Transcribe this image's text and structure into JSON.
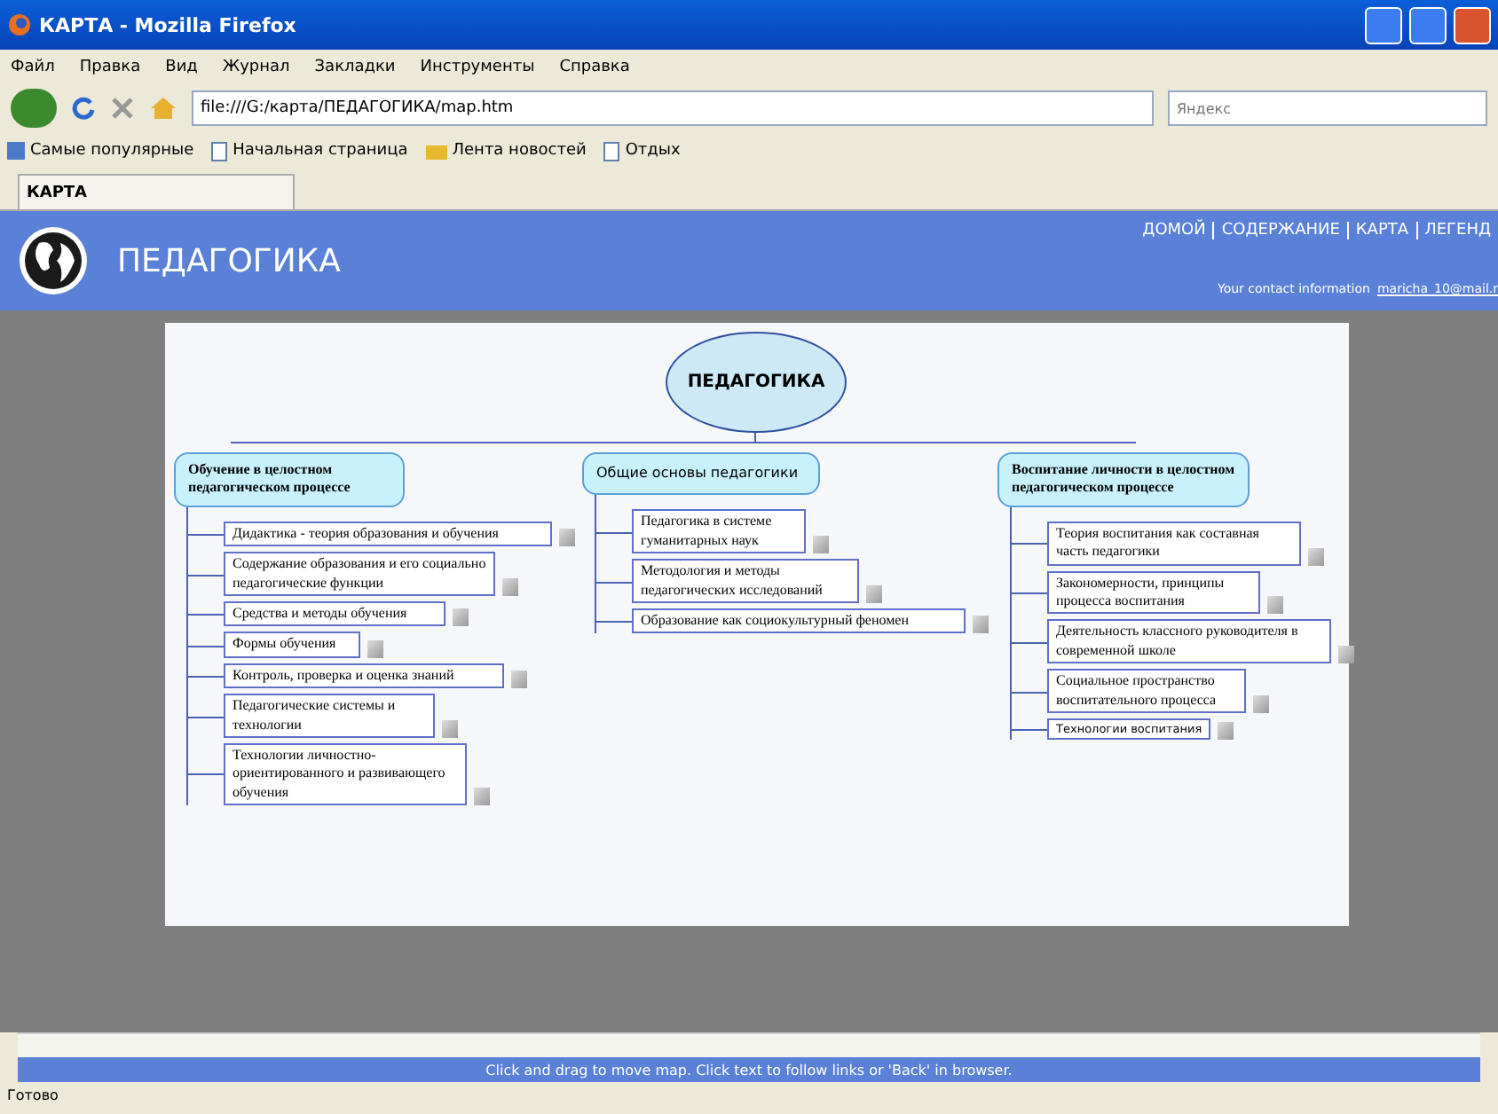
{
  "window": {
    "title": "КАРТА - Mozilla Firefox"
  },
  "menu": [
    "Файл",
    "Правка",
    "Вид",
    "Журнал",
    "Закладки",
    "Инструменты",
    "Справка"
  ],
  "address": {
    "value": "file:///G:/карта/ПЕДАГОГИКА/map.htm"
  },
  "search": {
    "placeholder": "Яндекс"
  },
  "bookmarks": [
    {
      "label": "Самые популярные",
      "kind": "special"
    },
    {
      "label": "Начальная страница",
      "kind": "page"
    },
    {
      "label": "Лента новостей",
      "kind": "feed"
    },
    {
      "label": "Отдых",
      "kind": "page"
    }
  ],
  "tabs": [
    {
      "label": "КАРТА",
      "selected": true
    }
  ],
  "site": {
    "title": "ПЕДАГОГИКА",
    "nav": [
      "ДОМОЙ",
      "СОДЕРЖАНИЕ",
      "КАРТА",
      "ЛЕГЕНД"
    ],
    "contact_label": "Your contact information",
    "contact_link": "maricha_10@mail.r"
  },
  "map": {
    "root": "ПЕДАГОГИКА",
    "branches": [
      {
        "title": "Обучение в целостном педагогическом процессе",
        "bold": true,
        "children": [
          "Дидактика - теория образования и обучения",
          "Содержание образования и его социально педагогические функции",
          "Средства и методы обучения",
          "Формы обучения",
          "Контроль, проверка и оценка знаний",
          "Педагогические системы и технологии",
          "Технологии личностно-ориентированного и развивающего обучения"
        ]
      },
      {
        "title": "Общие основы педагогики",
        "bold": false,
        "children": [
          "Педагогика в системе гуманитарных наук",
          "Методология и методы педагогических исследований",
          "Образование как социокультурный феномен"
        ]
      },
      {
        "title": "Воспитание личности в целостном педагогическом процессе",
        "bold": true,
        "children": [
          "Теория воспитания как составная часть педагогики",
          "Закономерности, принципы процесса воспитания",
          "Деятельность классного руководителя в современной школе",
          "Социальное пространство воспитательного процесса",
          "Технологии воспитания"
        ]
      }
    ]
  },
  "hint": "Click and drag to move map. Click text to follow links or 'Back' in browser.",
  "status_bar": "Готово"
}
